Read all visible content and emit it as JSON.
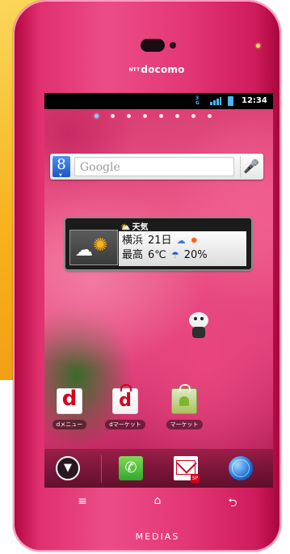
{
  "device": {
    "brand": "docomo",
    "brand_prefix": "NTT",
    "model": "MEDIAS"
  },
  "statusbar": {
    "network": "3G",
    "time": "12:34"
  },
  "home": {
    "page_count": 8,
    "active_page": 0
  },
  "search": {
    "placeholder": "Google",
    "logo": "8"
  },
  "weather": {
    "title": "天気",
    "city": "横浜",
    "date": "21日",
    "label_high": "最高",
    "temp": "6℃",
    "rain": "20%"
  },
  "apps": [
    {
      "label": "dメニュー",
      "icon": "d"
    },
    {
      "label": "dマーケット",
      "icon": "d"
    },
    {
      "label": "マーケット",
      "icon": "market-bag-icon"
    }
  ],
  "dock": [
    "apps-drawer-icon",
    "phone-icon",
    "mail-icon",
    "browser-icon"
  ],
  "hardware_keys": [
    "≡",
    "⌂",
    "⮌"
  ],
  "colors": {
    "body": "#e23774",
    "docomo_red": "#d6001c",
    "accent_blue": "#47b7ff"
  }
}
